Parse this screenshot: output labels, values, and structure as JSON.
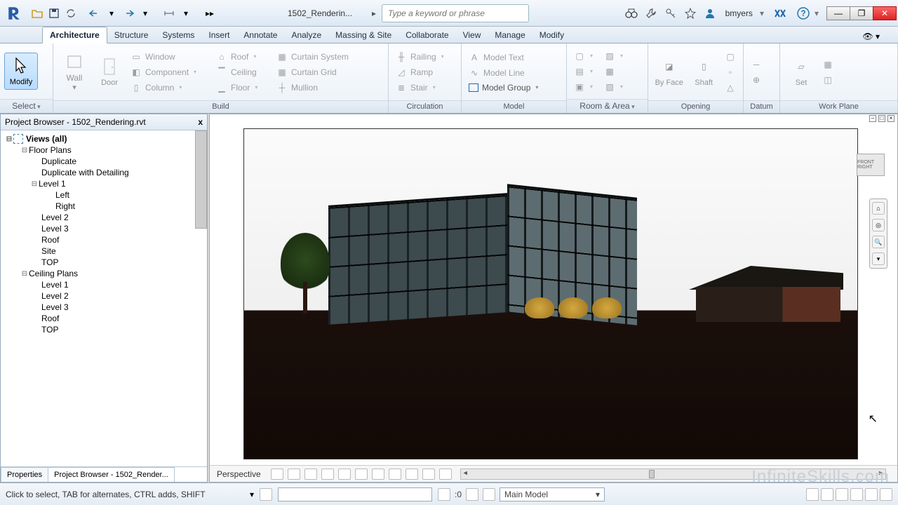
{
  "window": {
    "doc_title": "1502_Renderin...",
    "search_placeholder": "Type a keyword or phrase",
    "user": "bmyers"
  },
  "ribbon": {
    "tabs": [
      "Architecture",
      "Structure",
      "Systems",
      "Insert",
      "Annotate",
      "Analyze",
      "Massing & Site",
      "Collaborate",
      "View",
      "Manage",
      "Modify"
    ],
    "active_tab": "Architecture",
    "panels": {
      "select": {
        "title": "Select",
        "modify": "Modify"
      },
      "build": {
        "title": "Build",
        "wall": "Wall",
        "door": "Door",
        "window": "Window",
        "component": "Component",
        "column": "Column",
        "roof": "Roof",
        "ceiling": "Ceiling",
        "floor": "Floor",
        "curtain_system": "Curtain  System",
        "curtain_grid": "Curtain  Grid",
        "mullion": "Mullion"
      },
      "circulation": {
        "title": "Circulation",
        "railing": "Railing",
        "ramp": "Ramp",
        "stair": "Stair"
      },
      "model": {
        "title": "Model",
        "text": "Model  Text",
        "line": "Model  Line",
        "group": "Model  Group"
      },
      "room": {
        "title": "Room & Area"
      },
      "opening": {
        "title": "Opening",
        "byface": "By Face",
        "shaft": "Shaft"
      },
      "datum": {
        "title": "Datum"
      },
      "workplane": {
        "title": "Work Plane",
        "set": "Set"
      }
    }
  },
  "browser": {
    "title": "Project Browser - 1502_Rendering.rvt",
    "views_root": "Views (all)",
    "floor_plans": "Floor Plans",
    "ceiling_plans": "Ceiling Plans",
    "items": {
      "duplicate": "Duplicate",
      "duplicate_detailing": "Duplicate with Detailing",
      "level1": "Level 1",
      "left": "Left",
      "right": "Right",
      "level2": "Level 2",
      "level3": "Level 3",
      "roof": "Roof",
      "site": "Site",
      "top": "TOP"
    },
    "tabs": {
      "properties": "Properties",
      "browser": "Project Browser - 1502_Render..."
    }
  },
  "viewport": {
    "mode": "Perspective",
    "navcube": "FRONT RIGHT"
  },
  "status": {
    "msg": "Click to select, TAB for alternates, CTRL adds, SHIFT",
    "zero": ":0",
    "design_option": "Main Model"
  },
  "watermark": "InfiniteSkills.com"
}
